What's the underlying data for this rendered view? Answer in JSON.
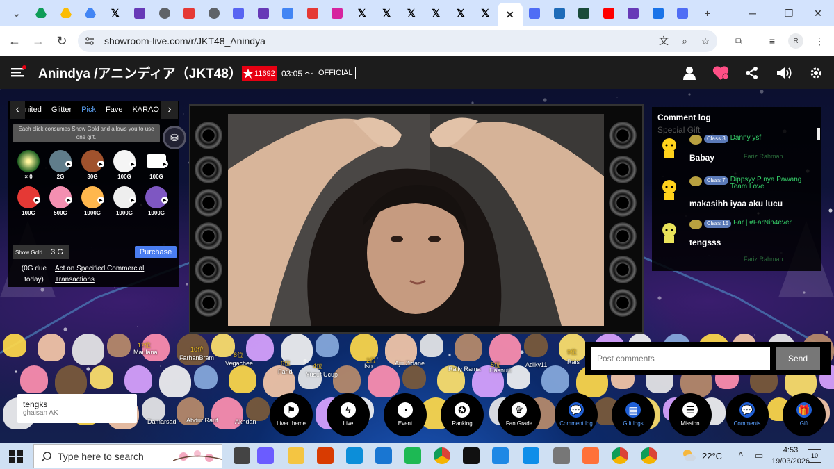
{
  "browser": {
    "tabs": [
      {
        "icon": "chevron-down-icon",
        "color": "#5f6368"
      },
      {
        "icon": "google-drive-icon",
        "color": "#0f9d58"
      },
      {
        "icon": "google-drive-icon",
        "color": "#fbbc04"
      },
      {
        "icon": "google-drive-icon",
        "color": "#4285f4"
      },
      {
        "icon": "x-logo-icon",
        "color": "#000000"
      },
      {
        "icon": "forms-icon",
        "color": "#673ab7"
      },
      {
        "icon": "globe-icon",
        "color": "#5f6368"
      },
      {
        "icon": "brand-red-icon",
        "color": "#e53935"
      },
      {
        "icon": "globe-icon",
        "color": "#5f6368"
      },
      {
        "icon": "discord-icon",
        "color": "#5865f2"
      },
      {
        "icon": "forms-icon",
        "color": "#673ab7"
      },
      {
        "icon": "google-icon",
        "color": "#4285f4"
      },
      {
        "icon": "idn-icon",
        "color": "#e53935"
      },
      {
        "icon": "instagram-icon",
        "color": "#d6249f"
      },
      {
        "icon": "x-logo-icon",
        "color": "#000000"
      },
      {
        "icon": "x-logo-icon",
        "color": "#000000"
      },
      {
        "icon": "x-logo-icon",
        "color": "#000000"
      },
      {
        "icon": "x-logo-icon",
        "color": "#000000"
      },
      {
        "icon": "x-logo-icon",
        "color": "#000000"
      },
      {
        "icon": "x-logo-icon",
        "color": "#000000"
      },
      {
        "icon": "close-icon",
        "color": "#222222",
        "active": true
      },
      {
        "icon": "heart-shield-icon",
        "color": "#4f6df5"
      },
      {
        "icon": "stack-icon",
        "color": "#1e6bb8"
      },
      {
        "icon": "box-icon",
        "color": "#1a4b3a"
      },
      {
        "icon": "youtube-icon",
        "color": "#ff0000"
      },
      {
        "icon": "forms-icon",
        "color": "#673ab7"
      },
      {
        "icon": "download-icon",
        "color": "#1a73e8"
      },
      {
        "icon": "heart-shield-icon",
        "color": "#4f6df5"
      },
      {
        "icon": "plus-icon",
        "color": "#444444"
      }
    ],
    "url": "showroom-live.com/r/JKT48_Anindya",
    "profile_initial": "R"
  },
  "header": {
    "title": "Anindya /アニンディア（JKT48）",
    "star_count": "11692",
    "start_time": "03:05 〜",
    "official_label": "OFFICIAL"
  },
  "gift_panel": {
    "tabs": [
      "nited",
      "Glitter",
      "Pick",
      "Fave",
      "KARAO"
    ],
    "selected_tab": "Pick",
    "note": "Each click consumes Show Gold and allows you to use one gift.",
    "gifts": [
      {
        "label": "× 0",
        "color": "#1b5e20"
      },
      {
        "label": "2G",
        "color": "#607d8b"
      },
      {
        "label": "30G",
        "color": "#a0522d"
      },
      {
        "label": "100G",
        "color": "#f5f5f5"
      },
      {
        "label": "100G",
        "color": "#ffffff"
      },
      {
        "label": "100G",
        "color": "#e53935"
      },
      {
        "label": "500G",
        "color": "#f48fb1"
      },
      {
        "label": "1000G",
        "color": "#ffb74d"
      },
      {
        "label": "1000G",
        "color": "#eeeeee"
      },
      {
        "label": "1000G",
        "color": "#7e57c2"
      }
    ],
    "show_gold_label": "Show Gold",
    "show_gold_value": "3 G",
    "purchase_label": "Purchase",
    "due_text": "(0G due today)",
    "link_text": "Act on Specified Commercial Transactions"
  },
  "comment_log": {
    "title": "Comment log",
    "ghost_label": "Special Gift",
    "entries": [
      {
        "class": "Class 3",
        "name": "Danny ysf",
        "text": "Babay"
      },
      {
        "class": "Class 7",
        "name": "Dippsyy P nya Pawang Team Love",
        "text": "makasihh iyaa aku lucu"
      },
      {
        "class": "Class 15",
        "name": "Far | #FarNin4ever",
        "text": "tengsss"
      }
    ],
    "ghost_names": [
      "Fariz Rahman",
      "Fariz Rahman"
    ]
  },
  "post": {
    "placeholder": "Post comments",
    "send_label": "Send"
  },
  "toast": {
    "title": "tengks",
    "user": "ghaisan AK"
  },
  "crowd_names": [
    "12位",
    "Maulana",
    "10位",
    "FarhanBram",
    "8位",
    "Vegachee",
    "6位",
    "Farid",
    "4位",
    "Yusuf Ucup",
    "2位",
    "Iso",
    "Aju Zidane",
    "Rally Rama",
    "5位",
    "Hasnuill",
    "Adiky11",
    "9位",
    "Rais",
    "Damarsad",
    "Abdur Rauf",
    "Akhdan"
  ],
  "bottom_nav": [
    {
      "label": "Liver theme",
      "icon": "flag-icon"
    },
    {
      "label": "Live",
      "icon": "bolt-icon"
    },
    {
      "label": "Event",
      "icon": "clock-icon"
    },
    {
      "label": "Ranking",
      "icon": "medal-icon"
    },
    {
      "label": "Fan Grade",
      "icon": "trophy-icon"
    },
    {
      "label": "Comment log",
      "icon": "chat-bubble-icon",
      "blue": true
    },
    {
      "label": "Gift logs",
      "icon": "list-icon",
      "blue": true
    },
    {
      "label": "Mission",
      "icon": "checklist-icon"
    },
    {
      "label": "Comments",
      "icon": "chat-bubble-icon",
      "blue": true
    },
    {
      "label": "Gift",
      "icon": "gift-icon",
      "blue": true
    }
  ],
  "taskbar": {
    "search_placeholder": "Type here to search",
    "temperature": "22°C",
    "time": "4:53",
    "date": "19/03/2026",
    "notifications": "10"
  }
}
